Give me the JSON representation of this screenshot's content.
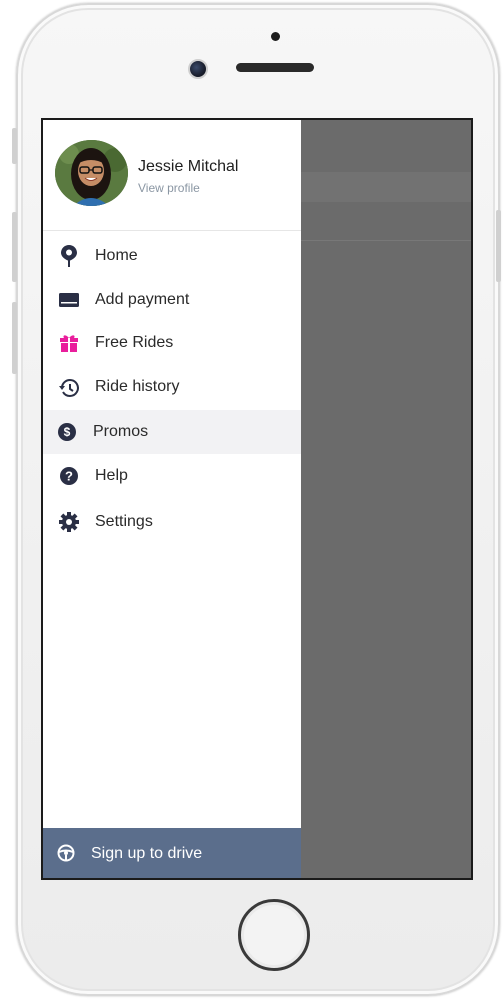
{
  "profile": {
    "name": "Jessie Mitchal",
    "view_profile": "View profile"
  },
  "menu": {
    "items": [
      {
        "label": "Home",
        "icon": "map-pin-icon"
      },
      {
        "label": "Add payment",
        "icon": "credit-card-icon"
      },
      {
        "label": "Free Rides",
        "icon": "gift-icon",
        "icon_color": "#e91e9c"
      },
      {
        "label": "Ride history",
        "icon": "history-icon"
      },
      {
        "label": "Promos",
        "icon": "dollar-icon",
        "active": true
      },
      {
        "label": "Help",
        "icon": "help-icon"
      },
      {
        "label": "Settings",
        "icon": "gear-icon"
      }
    ]
  },
  "footer": {
    "signup_label": "Sign up to drive",
    "icon": "steering-wheel-icon",
    "background": "#5b6e8c"
  },
  "colors": {
    "icon": "#2a2f45",
    "gift_icon": "#e91e9c",
    "active_row": "#f2f2f4",
    "scrim": "#6b6b6b"
  }
}
